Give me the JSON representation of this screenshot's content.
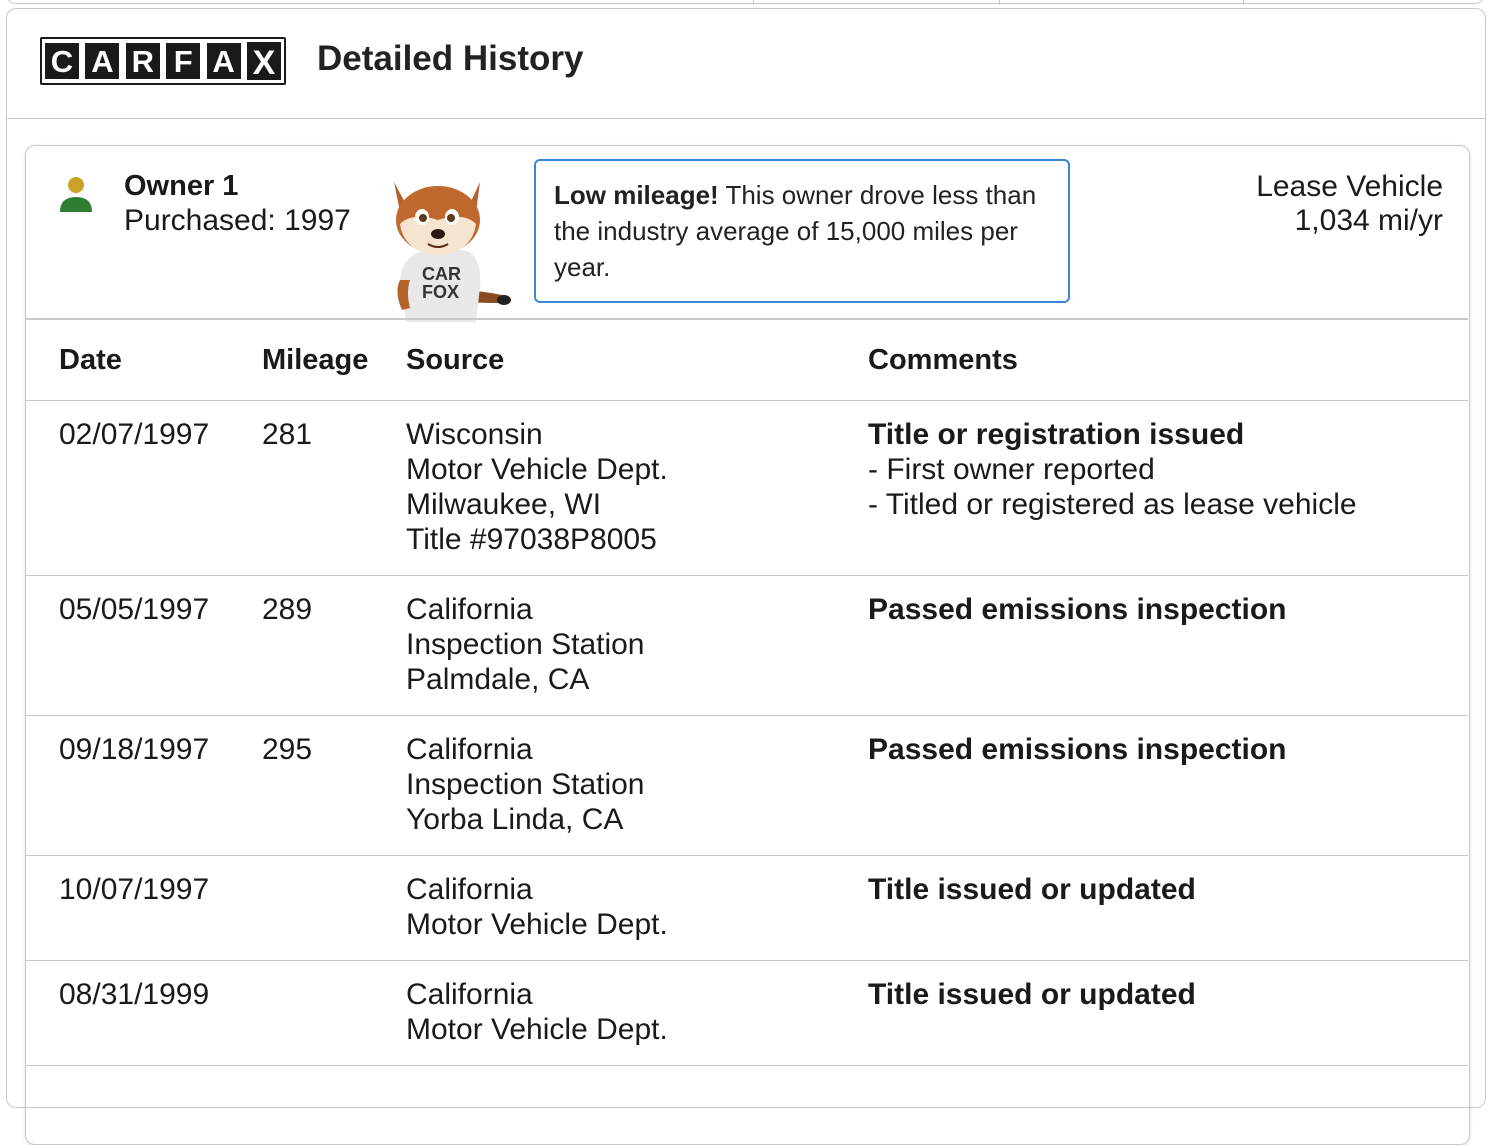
{
  "header": {
    "logo_letters": [
      "C",
      "A",
      "R",
      "F",
      "A",
      "X"
    ],
    "title": "Detailed History"
  },
  "owner": {
    "name": "Owner 1",
    "purchased": "Purchased: 1997",
    "callout_bold": "Low mileage!",
    "callout_text": " This owner drove less than the industry average of 15,000 miles per year.",
    "type": "Lease Vehicle",
    "miles_per_year": "1,034 mi/yr",
    "mascot_shirt": [
      "CAR",
      "FOX"
    ]
  },
  "table": {
    "headers": {
      "date": "Date",
      "mileage": "Mileage",
      "source": "Source",
      "comments": "Comments"
    },
    "rows": [
      {
        "date": "02/07/1997",
        "mileage": "281",
        "source": [
          "Wisconsin",
          "Motor Vehicle Dept.",
          "Milwaukee, WI",
          "Title #97038P8005"
        ],
        "comment_title": "Title or registration issued",
        "comment_items": [
          "- First owner reported",
          "- Titled or registered as lease vehicle"
        ]
      },
      {
        "date": "05/05/1997",
        "mileage": "289",
        "source": [
          "California",
          "Inspection Station",
          "Palmdale, CA"
        ],
        "comment_title": "Passed emissions inspection",
        "comment_items": []
      },
      {
        "date": "09/18/1997",
        "mileage": "295",
        "source": [
          "California",
          "Inspection Station",
          "Yorba Linda, CA"
        ],
        "comment_title": "Passed emissions inspection",
        "comment_items": []
      },
      {
        "date": "10/07/1997",
        "mileage": "",
        "source": [
          "California",
          "Motor Vehicle Dept."
        ],
        "comment_title": "Title issued or updated",
        "comment_items": []
      },
      {
        "date": "08/31/1999",
        "mileage": "",
        "source": [
          "California",
          "Motor Vehicle Dept."
        ],
        "comment_title": "Title issued or updated",
        "comment_items": []
      }
    ]
  },
  "colors": {
    "callout_border": "#3a86d4",
    "owner_icon_head": "#c9a227",
    "owner_icon_body": "#2e7d32"
  }
}
